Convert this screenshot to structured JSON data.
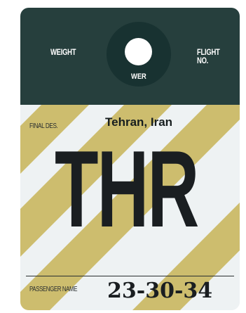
{
  "header": {
    "weight_label": "WEIGHT",
    "flight_label": "FLIGHT NO.",
    "hole_label": "WER"
  },
  "body": {
    "final_destination_label": "FINAL DES.",
    "city": "Tehran, Iran",
    "airport_code": "THR",
    "passenger_name_label": "PASSENGER NAME",
    "passenger_name_value": "23-30-34"
  },
  "colors": {
    "header_background": "#263f3d",
    "stripe_gold": "#cdbd6e",
    "stripe_light": "#eef2f3",
    "text_dark": "#1a1e21"
  }
}
